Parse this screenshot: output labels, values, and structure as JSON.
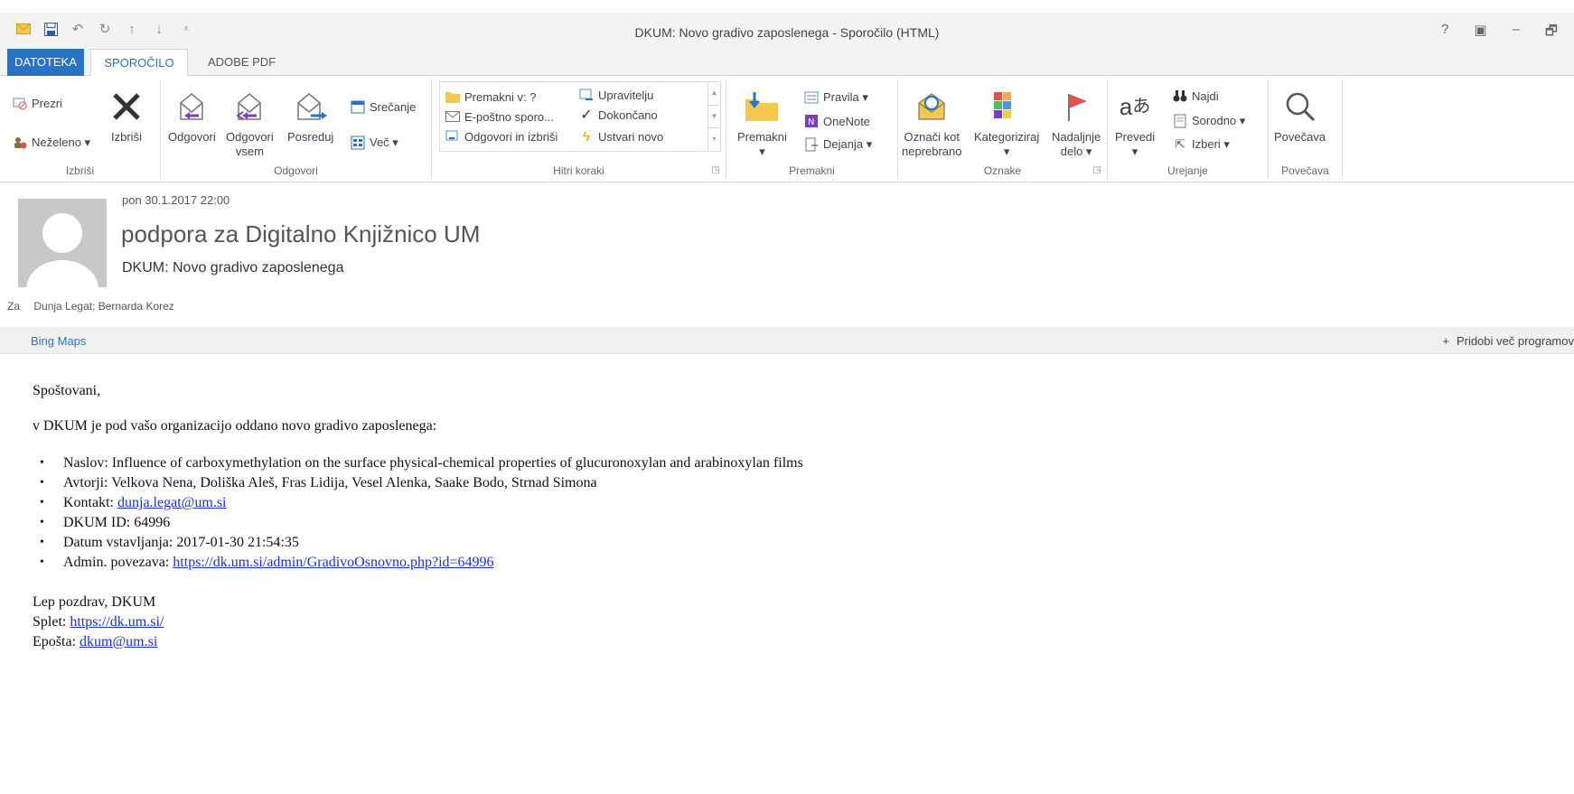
{
  "window": {
    "title": "DKUM: Novo gradivo zaposlenega - Sporočilo (HTML)",
    "help": "?",
    "controls": [
      "?",
      "▣",
      "–",
      "🗗"
    ]
  },
  "tabs": [
    {
      "label": "DATOTEKA"
    },
    {
      "label": "SPOROČILO"
    },
    {
      "label": "ADOBE PDF"
    }
  ],
  "ribbon": {
    "delete": {
      "group_label": "Izbriši",
      "ignore": "Prezri",
      "junk": "Neželeno ▾",
      "delete": "Izbriši"
    },
    "respond": {
      "group_label": "Odgovori",
      "reply": "Odgovori",
      "reply_all_1": "Odgovori",
      "reply_all_2": "vsem",
      "forward": "Posreduj",
      "meeting": "Srečanje",
      "more": "Več ▾"
    },
    "quick_steps": {
      "group_label": "Hitri koraki",
      "move_to": "Premakni v: ?",
      "to_manager": "Upravitelju",
      "email": "E-poštno sporo...",
      "done": "Dokončano",
      "reply_delete": "Odgovori in izbriši",
      "create_new": "Ustvari novo"
    },
    "move": {
      "group_label": "Premakni",
      "move": "Premakni",
      "rules": "Pravila ▾",
      "onenote": "OneNote",
      "actions": "Dejanja ▾"
    },
    "tags": {
      "group_label": "Oznake",
      "mark_unread_1": "Označi kot",
      "mark_unread_2": "neprebrano",
      "categorize": "Kategoriziraj",
      "followup_1": "Nadaljnje",
      "followup_2": "delo ▾"
    },
    "editing": {
      "group_label": "Urejanje",
      "translate": "Prevedi",
      "find": "Najdi",
      "related": "Sorodno ▾",
      "select": "Izberi ▾"
    },
    "zoom": {
      "group_label": "Povečava",
      "zoom": "Povečava"
    }
  },
  "message": {
    "datetime": "pon 30.1.2017 22:00",
    "sender": "podpora za Digitalno Knjižnico UM",
    "subject": "DKUM: Novo gradivo zaposlenega",
    "to_label": "Za",
    "to": "Dunja Legat; Bernarda Korez"
  },
  "addins": {
    "bing": "Bing Maps",
    "get_more": "Pridobi več programov"
  },
  "body": {
    "greeting": "Spoštovani,",
    "intro": "v DKUM je pod vašo organizacijo oddano novo gradivo zaposlenega:",
    "items": {
      "title_label": "Naslov: ",
      "title": "Influence of carboxymethylation on the surface physical-chemical properties of glucuronoxylan and arabinoxylan films",
      "authors_label": "Avtorji: ",
      "authors": "Velkova Nena, Doliška Aleš, Fras Lidija, Vesel Alenka, Saake Bodo, Strnad Simona",
      "contact_label": "Kontakt: ",
      "contact": "dunja.legat@um.si",
      "id_label": "DKUM ID: ",
      "id": "64996",
      "date_label": "Datum vstavljanja: ",
      "date": "2017-01-30 21:54:35",
      "admin_label": "Admin. povezava: ",
      "admin": "https://dk.um.si/admin/GradivoOsnovno.php?id=64996"
    },
    "sig_line1": "Lep pozdrav, DKUM",
    "web_label": "Splet: ",
    "web": "https://dk.um.si/",
    "mail_label": "Epošta: ",
    "mail": "dkum@um.si"
  }
}
